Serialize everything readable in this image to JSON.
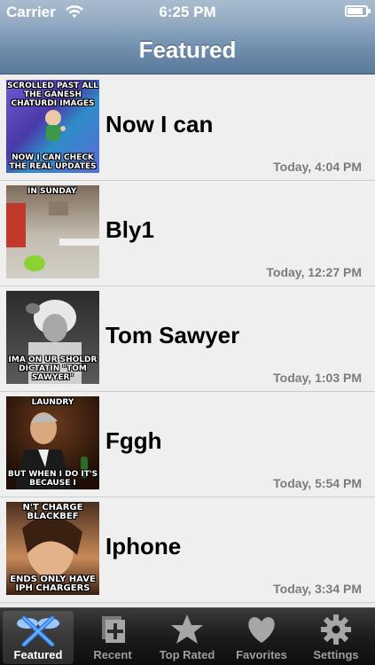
{
  "status_bar": {
    "carrier": "Carrier",
    "time": "6:25 PM",
    "battery_level": 0.85
  },
  "nav": {
    "title": "Featured"
  },
  "list": {
    "items": [
      {
        "name": "Now I can",
        "date": "Today, 4:04 PM",
        "caption_top": "SCROLLED PAST ALL THE GANESH CHATURDI IMAGES",
        "caption_bottom": "NOW I CAN CHECK THE REAL UPDATES"
      },
      {
        "name": "Bly1",
        "date": "Today, 12:27 PM",
        "caption_top": "IN SUNDAY",
        "caption_bottom": ""
      },
      {
        "name": "Tom Sawyer",
        "date": "Today, 1:03 PM",
        "caption_top": "",
        "caption_bottom": "IMA ON UR SHOLDR DICTATIN \"TOM SAWYER\""
      },
      {
        "name": "Fggh",
        "date": "Today, 5:54 PM",
        "caption_top": "LAUNDRY",
        "caption_bottom": "BUT WHEN I DO IT'S BECAUSE I"
      },
      {
        "name": "Iphone",
        "date": "Today, 3:34 PM",
        "caption_top": "N'T CHARGE BLACKBEF",
        "caption_bottom": "ENDS ONLY HAVE IPH CHARGERS"
      }
    ]
  },
  "tabs": [
    {
      "label": "Featured",
      "icon": "featured-icon",
      "active": true
    },
    {
      "label": "Recent",
      "icon": "recent-icon",
      "active": false
    },
    {
      "label": "Top Rated",
      "icon": "star-icon",
      "active": false
    },
    {
      "label": "Favorites",
      "icon": "heart-icon",
      "active": false
    },
    {
      "label": "Settings",
      "icon": "gear-icon",
      "active": false
    }
  ],
  "colors": {
    "nav_gradient_top": "#8ea8c2",
    "nav_gradient_bottom": "#5a7a9c",
    "list_background": "#efefef",
    "date_text": "#7b7b7b",
    "tab_bar": "#1c1c1c",
    "tab_active_icon": "#3a8be0"
  }
}
